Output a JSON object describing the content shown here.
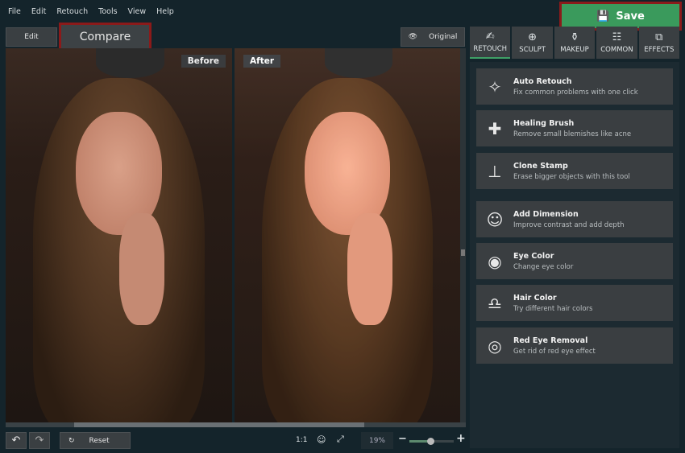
{
  "menu": [
    "File",
    "Edit",
    "Retouch",
    "Tools",
    "View",
    "Help"
  ],
  "toolbar": {
    "edit": "Edit",
    "compare": "Compare",
    "original": "Original",
    "save": "Save"
  },
  "canvas": {
    "before": "Before",
    "after": "After"
  },
  "tabs": [
    {
      "label": "RETOUCH",
      "icon": "✍"
    },
    {
      "label": "SCULPT",
      "icon": "⊕"
    },
    {
      "label": "MAKEUP",
      "icon": "⚱"
    },
    {
      "label": "COMMON",
      "icon": "☷"
    },
    {
      "label": "EFFECTS",
      "icon": "⧉"
    }
  ],
  "tools": [
    {
      "title": "Auto Retouch",
      "desc": "Fix common problems with one click",
      "icon": "✧"
    },
    {
      "title": "Healing Brush",
      "desc": "Remove small blemishes like acne",
      "icon": "✚"
    },
    {
      "title": "Clone Stamp",
      "desc": "Erase bigger objects with this tool",
      "icon": "⊥"
    },
    {
      "title": "Add Dimension",
      "desc": "Improve contrast and add depth",
      "icon": "☺"
    },
    {
      "title": "Eye Color",
      "desc": "Change eye color",
      "icon": "◉"
    },
    {
      "title": "Hair Color",
      "desc": "Try different hair colors",
      "icon": "♎"
    },
    {
      "title": "Red Eye Removal",
      "desc": "Get rid of red eye effect",
      "icon": "◎"
    }
  ],
  "bottom": {
    "reset": "Reset",
    "ratio": "1:1",
    "zoom": "19%",
    "zoom_value_percent": 19
  },
  "colors": {
    "save": "#3a9a5c",
    "highlight": "#8b1a1a",
    "active_tab": "#3fa066"
  }
}
